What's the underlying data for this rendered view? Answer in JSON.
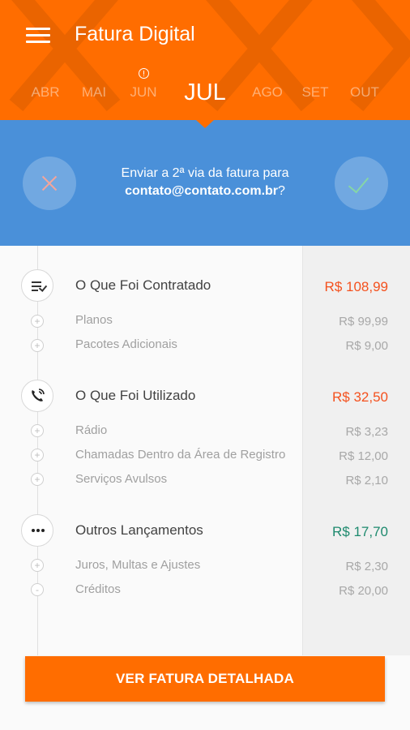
{
  "header": {
    "title": "Fatura Digital"
  },
  "months": [
    {
      "label": "ABR",
      "active": false
    },
    {
      "label": "MAI",
      "active": false
    },
    {
      "label": "JUN",
      "active": false,
      "alert": true
    },
    {
      "label": "JUL",
      "active": true
    },
    {
      "label": "AGO",
      "active": false
    },
    {
      "label": "SET",
      "active": false
    },
    {
      "label": "OUT",
      "active": false
    }
  ],
  "confirm": {
    "line1": "Enviar a 2ª via da fatura para",
    "email": "contato@contato.com.br",
    "question": "?"
  },
  "sections": [
    {
      "title": "O Que Foi Contratado",
      "price": "R$ 108,99",
      "icon": "checklist-icon",
      "color": "#f4511e",
      "items": [
        {
          "label": "Planos",
          "price": "R$ 99,99",
          "sign": "+"
        },
        {
          "label": "Pacotes Adicionais",
          "price": "R$ 9,00",
          "sign": "+"
        }
      ]
    },
    {
      "title": "O Que Foi Utilizado",
      "price": "R$ 32,50",
      "icon": "phone-icon",
      "color": "#f4511e",
      "items": [
        {
          "label": "Rádio",
          "price": "R$ 3,23",
          "sign": "+"
        },
        {
          "label": "Chamadas Dentro da Área de Registro",
          "price": "R$ 12,00",
          "sign": "+"
        },
        {
          "label": "Serviços Avulsos",
          "price": "R$ 2,10",
          "sign": "+"
        }
      ]
    },
    {
      "title": "Outros Lançamentos",
      "price": "R$ 17,70",
      "icon": "more-icon",
      "color": "#1e8a6e",
      "items": [
        {
          "label": "Juros, Multas e Ajustes",
          "price": "R$ 2,30",
          "sign": "+"
        },
        {
          "label": "Créditos",
          "price": "R$ 20,00",
          "sign": "-"
        }
      ]
    }
  ],
  "cta": {
    "label": "VER FATURA DETALHADA"
  },
  "colors": {
    "brand_orange": "#ff6d00",
    "band_blue": "#4a90d9",
    "negative_green": "#1e8a6e"
  }
}
